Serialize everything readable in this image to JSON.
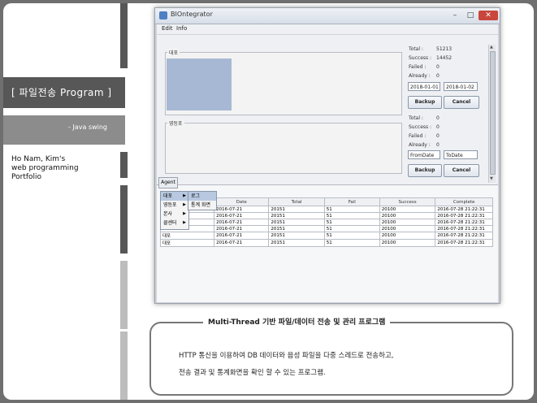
{
  "slide": {
    "title": "[ 파일전송 Program ]",
    "subtitle": "- Java swing",
    "author_lines": [
      "Ho Nam, Kim's",
      "web programming",
      "Portfolio"
    ]
  },
  "app": {
    "title": "BIOntegrator",
    "window_buttons": [
      "–",
      "□",
      "✕"
    ],
    "menu": [
      "Edit",
      "Info"
    ],
    "panel1": {
      "label": "대포",
      "stats": [
        {
          "label": "Total :",
          "value": "51213"
        },
        {
          "label": "Success :",
          "value": "14452"
        },
        {
          "label": "Failed :",
          "value": "0"
        },
        {
          "label": "Already :",
          "value": "0"
        }
      ],
      "from_date": "2018-01-01",
      "to_date": "2018-01-02",
      "backup": "Backup",
      "cancel": "Cancel"
    },
    "panel2": {
      "label": "영등포",
      "stats": [
        {
          "label": "Total :",
          "value": "0"
        },
        {
          "label": "Success :",
          "value": "0"
        },
        {
          "label": "Failed :",
          "value": "0"
        },
        {
          "label": "Already :",
          "value": "0"
        }
      ],
      "from_date": "FromDate",
      "to_date": "ToDate",
      "backup": "Backup",
      "cancel": "Cancel"
    },
    "agent_tab": "Agent",
    "table": {
      "headers": [
        "",
        "Date",
        "Total",
        "Fail",
        "Success",
        "Complete"
      ],
      "rows": [
        [
          "",
          "2016-07-21",
          "20151",
          "51",
          "20100",
          "2016-07-28 21:22:31"
        ],
        [
          "",
          "2016-07-21",
          "20151",
          "51",
          "20100",
          "2016-07-28 21:22:31"
        ],
        [
          "",
          "2016-07-21",
          "20151",
          "51",
          "20100",
          "2016-07-28 21:22:31"
        ],
        [
          "",
          "2016-07-21",
          "20151",
          "51",
          "20100",
          "2016-07-28 21:22:31"
        ],
        [
          "대포",
          "2016-07-21",
          "20151",
          "51",
          "20100",
          "2016-07-28 21:22:31"
        ],
        [
          "대포",
          "2016-07-21",
          "20151",
          "51",
          "20100",
          "2016-07-28 21:22:31"
        ]
      ]
    },
    "popup": [
      "대포",
      "영등포",
      "본사",
      "클센터"
    ],
    "submenu": [
      "로그",
      "통계 화면"
    ]
  },
  "description": {
    "heading": "Multi-Thread 기반 파일/데이터 전송 및 관리 프로그램",
    "lines": [
      "HTTP 통신을 이용하여 DB 데이터와 음성 파일을 다중 스레드로 전송하고,",
      "전송 결과 및 통계화면을 확인 할 수 있는 프로그램."
    ]
  }
}
